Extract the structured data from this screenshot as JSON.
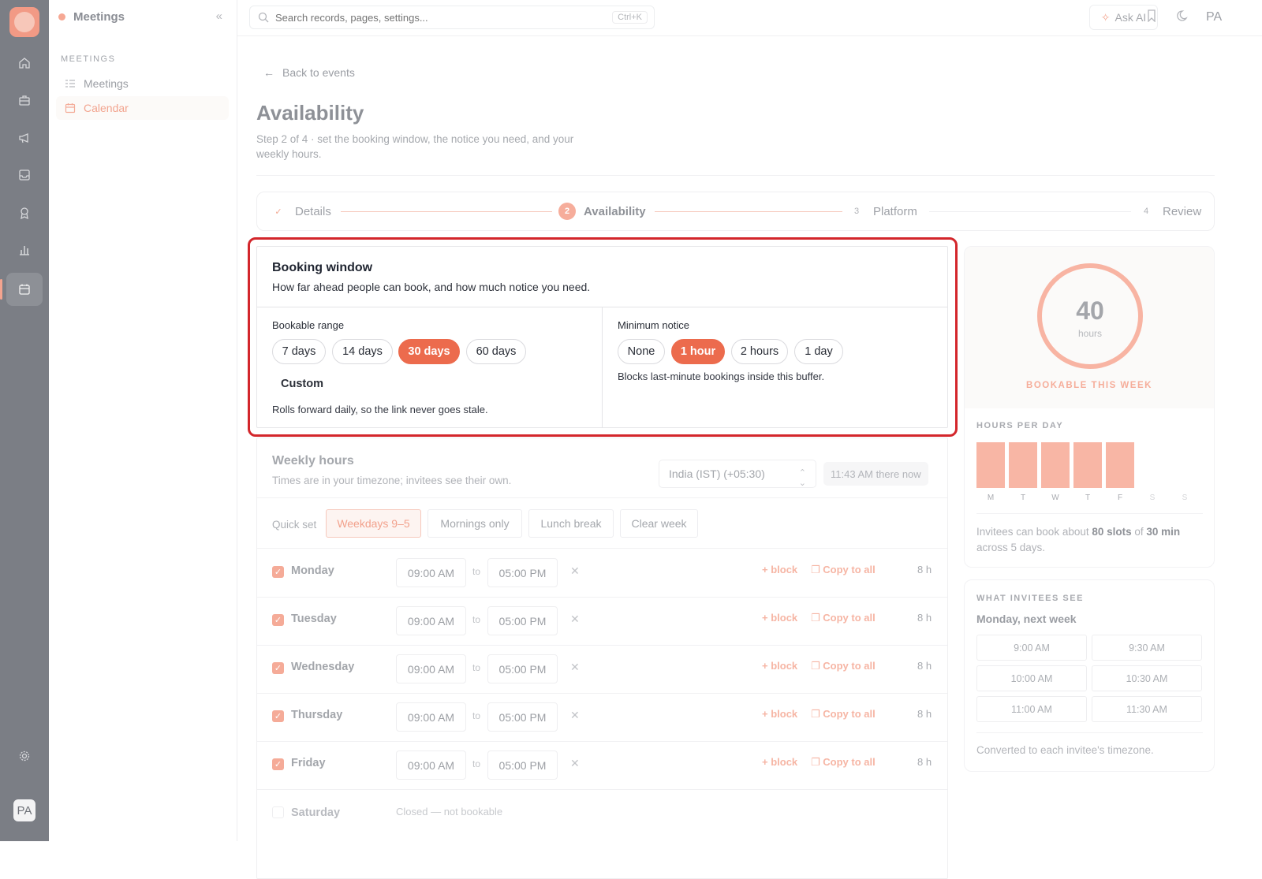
{
  "app": {
    "section_title": "Meetings",
    "user_initials": "PA"
  },
  "sidebar": {
    "section_label": "MEETINGS",
    "items": [
      {
        "label": "Meetings",
        "icon": "list-icon",
        "selected": false
      },
      {
        "label": "Calendar",
        "icon": "calendar-icon",
        "selected": true
      }
    ]
  },
  "topbar": {
    "search_placeholder": "Search records, pages, settings...",
    "search_shortcut": "Ctrl+K",
    "ask_ai_label": "Ask AI",
    "user_initials": "PA"
  },
  "page": {
    "back_label": "Back to events",
    "title": "Availability",
    "subtitle": "Step 2 of 4 · set the booking window, the notice you need, and your weekly hours."
  },
  "stepper": {
    "steps": [
      {
        "num": "✓",
        "label": "Details",
        "state": "done"
      },
      {
        "num": "2",
        "label": "Availability",
        "state": "current"
      },
      {
        "num": "3",
        "label": "Platform",
        "state": "todo"
      },
      {
        "num": "4",
        "label": "Review",
        "state": "todo"
      }
    ]
  },
  "booking_window": {
    "title": "Booking window",
    "description": "How far ahead people can book, and how much notice you need.",
    "range_label": "Bookable range",
    "range_options": [
      "7 days",
      "14 days",
      "30 days",
      "60 days",
      "Custom"
    ],
    "range_selected": "30 days",
    "range_note": "Rolls forward daily, so the link never goes stale.",
    "notice_label": "Minimum notice",
    "notice_options": [
      "None",
      "1 hour",
      "2 hours",
      "1 day"
    ],
    "notice_selected": "1 hour",
    "notice_note": "Blocks last-minute bookings inside this buffer."
  },
  "weekly_hours": {
    "title": "Weekly hours",
    "description": "Times are in your timezone; invitees see their own.",
    "timezone": "India (IST) (+05:30)",
    "now_label": "11:43 AM there now",
    "quick_set_label": "Quick set",
    "quick_options": [
      "Weekdays 9–5",
      "Mornings only",
      "Lunch break",
      "Clear week"
    ],
    "quick_selected": "Weekdays 9–5",
    "to_label": "to",
    "block_label": "+ block",
    "copy_label": "Copy to all",
    "days": [
      {
        "name": "Monday",
        "start": "09:00 AM",
        "end": "05:00 PM",
        "hours": "8 h",
        "enabled": true
      },
      {
        "name": "Tuesday",
        "start": "09:00 AM",
        "end": "05:00 PM",
        "hours": "8 h",
        "enabled": true
      },
      {
        "name": "Wednesday",
        "start": "09:00 AM",
        "end": "05:00 PM",
        "hours": "8 h",
        "enabled": true
      },
      {
        "name": "Thursday",
        "start": "09:00 AM",
        "end": "05:00 PM",
        "hours": "8 h",
        "enabled": true
      },
      {
        "name": "Friday",
        "start": "09:00 AM",
        "end": "05:00 PM",
        "hours": "8 h",
        "enabled": true
      }
    ],
    "saturday": {
      "name": "Saturday",
      "status": "Closed — not bookable"
    }
  },
  "summary": {
    "total_hours": "40",
    "total_unit": "hours",
    "caption": "BOOKABLE THIS WEEK",
    "per_day_label": "HOURS PER DAY",
    "per_day": [
      {
        "day": "M",
        "hours": 8
      },
      {
        "day": "T",
        "hours": 8
      },
      {
        "day": "W",
        "hours": 8
      },
      {
        "day": "T",
        "hours": 8
      },
      {
        "day": "F",
        "hours": 8
      },
      {
        "day": "S",
        "hours": 0
      },
      {
        "day": "S",
        "hours": 0
      }
    ],
    "invitees_text_1": "Invitees can book about ",
    "invitees_slots": "80 slots",
    "invitees_text_2": " of ",
    "invitees_duration": "30 min",
    "invitees_text_3": " across 5 days."
  },
  "preview": {
    "title": "WHAT INVITEES SEE",
    "day_label": "Monday, next week",
    "slots": [
      "9:00 AM",
      "9:30 AM",
      "10:00 AM",
      "10:30 AM",
      "11:00 AM",
      "11:30 AM"
    ],
    "footnote": "Converted to each invitee's timezone."
  },
  "colors": {
    "accent": "#ec6b4d",
    "accent_soft": "#f8b6a5",
    "highlight_outline": "#d3262b"
  }
}
